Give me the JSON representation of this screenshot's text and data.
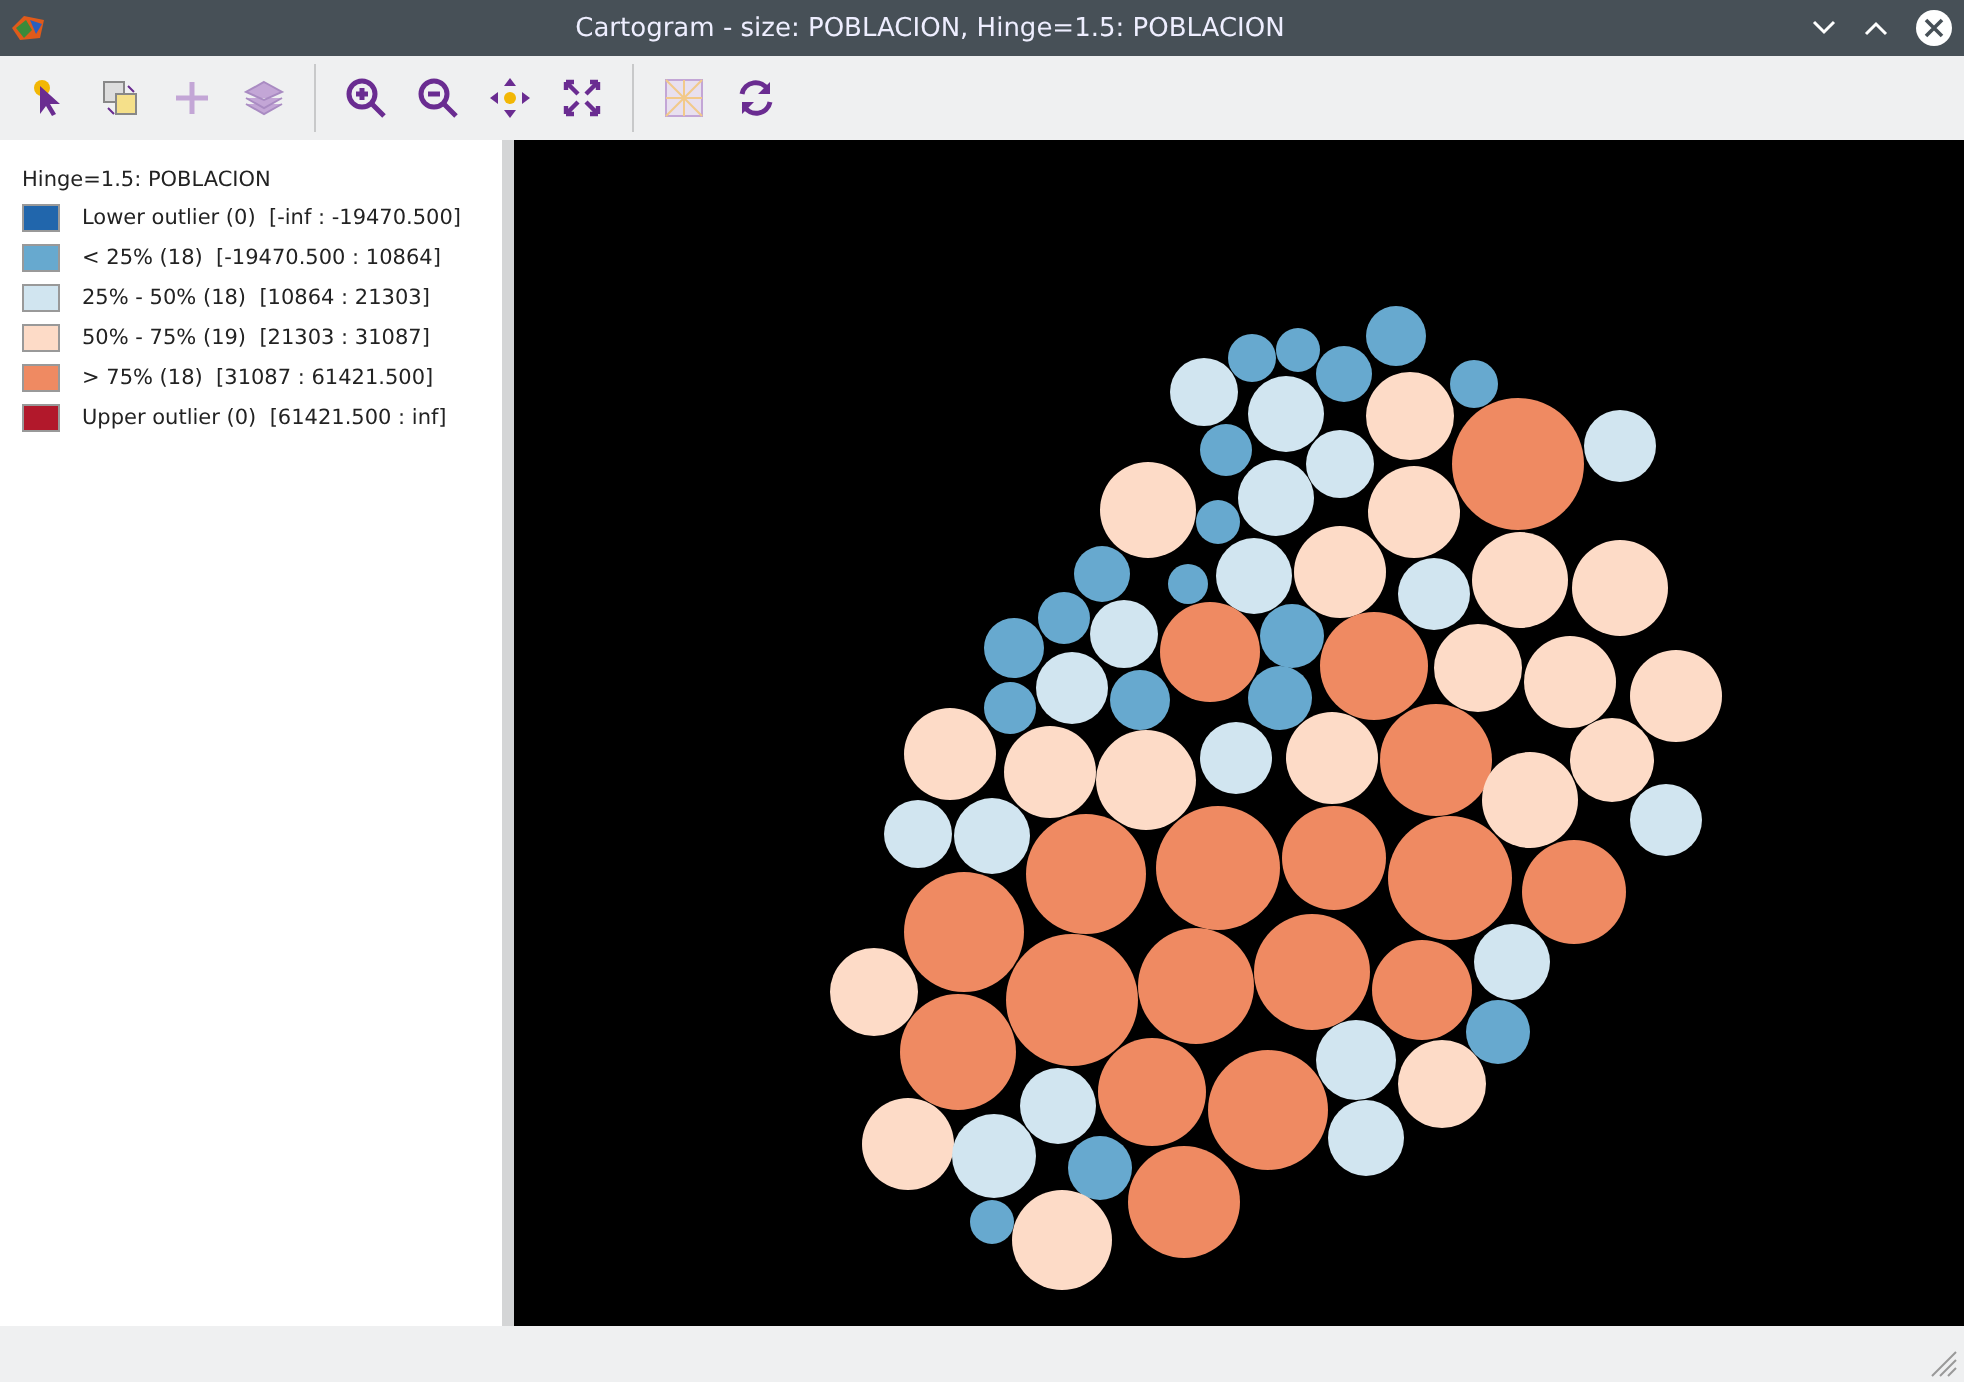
{
  "window": {
    "title": "Cartogram - size: POBLACION, Hinge=1.5: POBLACION"
  },
  "legend": {
    "title": "Hinge=1.5: POBLACION",
    "items": [
      {
        "label": "Lower outlier (0)  [-inf : -19470.500]",
        "color": "#2166ac"
      },
      {
        "label": "< 25% (18)  [-19470.500 : 10864]",
        "color": "#67a9cf"
      },
      {
        "label": "25% - 50% (18)  [10864 : 21303]",
        "color": "#d1e5f0"
      },
      {
        "label": "50% - 75% (19)  [21303 : 31087]",
        "color": "#fddbc7"
      },
      {
        "label": "> 75% (18)  [31087 : 61421.500]",
        "color": "#ef8a62"
      },
      {
        "label": "Upper outlier (0)  [61421.500 : inf]",
        "color": "#b2182b"
      }
    ]
  }
}
